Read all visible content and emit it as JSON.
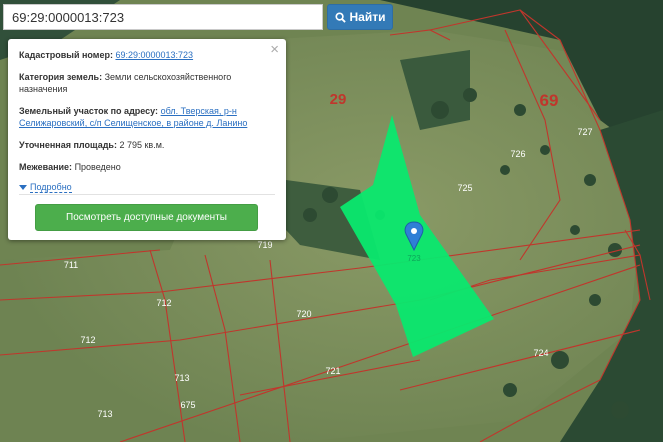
{
  "search": {
    "value": "69:29:0000013:723",
    "button_label": "Найти"
  },
  "card": {
    "cadastral_label": "Кадастровый номер:",
    "cadastral_value": "69:29:0000013:723",
    "category_label": "Категория земель:",
    "category_value": "Земли сельскохозяйственного назначения",
    "address_label": "Земельный участок по адресу:",
    "address_value": "обл. Тверская, р-н Селижаровский, с/п Селищенское, в районе д. Ланино",
    "area_label": "Уточненная площадь:",
    "area_value": "2 795 кв.м.",
    "survey_label": "Межевание:",
    "survey_value": "Проведено",
    "more_label": "Подробно",
    "docs_button": "Посмотреть доступные документы",
    "close_symbol": "×"
  },
  "map": {
    "quarter_labels": [
      "29",
      "69"
    ],
    "parcel_labels": [
      "727",
      "726",
      "725",
      "723",
      "719",
      "711",
      "712",
      "712",
      "720",
      "721",
      "713",
      "675",
      "713",
      "724"
    ],
    "selected_parcel_color": "#0ae86e",
    "boundary_color": "#c0362c",
    "marker_color": "#2f7fd6",
    "marker_icon": "map-pin-icon"
  }
}
